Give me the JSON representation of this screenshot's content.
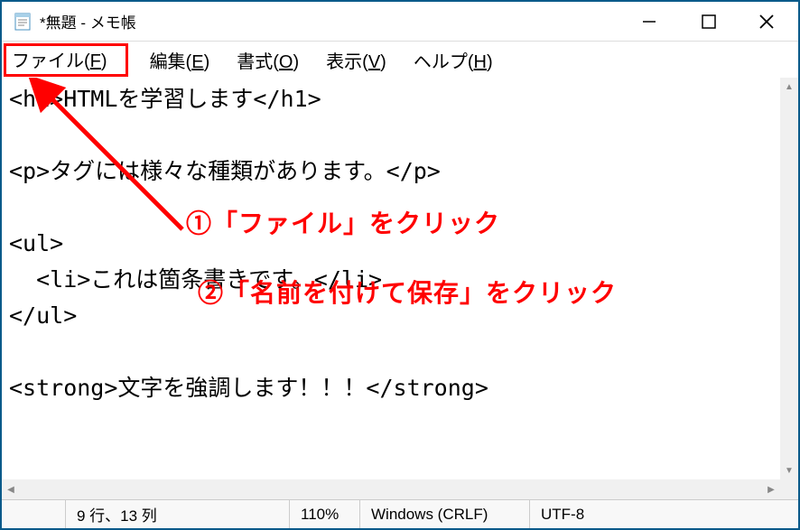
{
  "window": {
    "title": "*無題 - メモ帳"
  },
  "menu": {
    "file": {
      "label": "ファイル(",
      "accel": "F",
      "suffix": ")"
    },
    "edit": {
      "label": "編集(",
      "accel": "E",
      "suffix": ")"
    },
    "format": {
      "label": "書式(",
      "accel": "O",
      "suffix": ")"
    },
    "view": {
      "label": "表示(",
      "accel": "V",
      "suffix": ")"
    },
    "help": {
      "label": "ヘルプ(",
      "accel": "H",
      "suffix": ")"
    }
  },
  "editor": {
    "text": "<h1>HTMLを学習します</h1>\n\n<p>タグには様々な種類があります。</p>\n\n<ul>\n  <li>これは箇条書きです。</li>\n</ul>\n\n<strong>文字を強調します！！！</strong>"
  },
  "annotations": {
    "step1": "①「ファイル」をクリック",
    "step2": "②「名前を付けて保存」をクリック"
  },
  "status": {
    "position": "9 行、13 列",
    "zoom": "110%",
    "lineEnding": "Windows (CRLF)",
    "encoding": "UTF-8"
  }
}
